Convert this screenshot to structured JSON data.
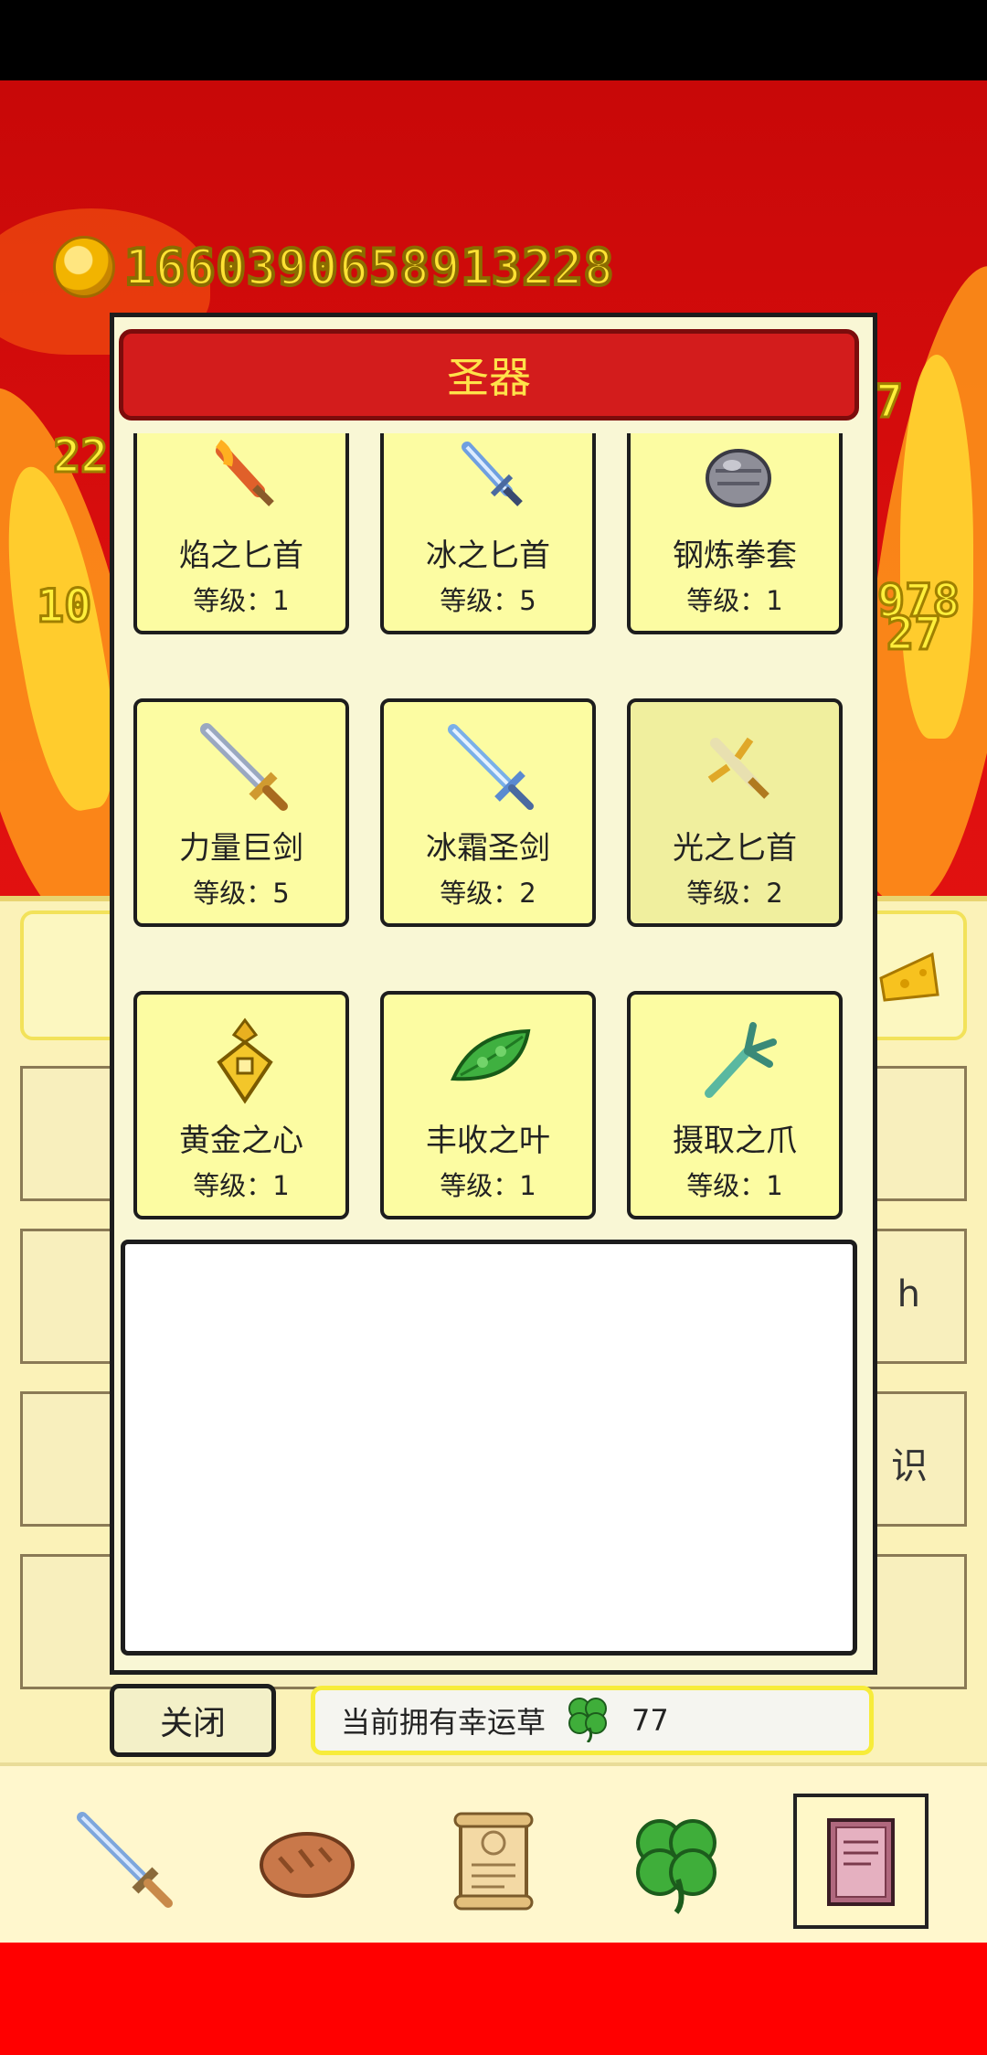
{
  "gold": {
    "amount": "1660390658913228"
  },
  "floating_numbers": [
    "22",
    "10",
    "978",
    "27",
    "7"
  ],
  "dialog": {
    "title": "圣器",
    "items": [
      {
        "name": "焰之匕首",
        "level": "等级：1",
        "icon": "flame-dagger-icon"
      },
      {
        "name": "冰之匕首",
        "level": "等级：5",
        "icon": "ice-dagger-icon"
      },
      {
        "name": "钢炼拳套",
        "level": "等级：1",
        "icon": "steel-gauntlet-icon"
      },
      {
        "name": "力量巨剑",
        "level": "等级：5",
        "icon": "power-greatsword-icon"
      },
      {
        "name": "冰霜圣剑",
        "level": "等级：2",
        "icon": "frost-holy-sword-icon"
      },
      {
        "name": "光之匕首",
        "level": "等级：2",
        "icon": "light-dagger-icon"
      },
      {
        "name": "黄金之心",
        "level": "等级：1",
        "icon": "golden-heart-icon"
      },
      {
        "name": "丰收之叶",
        "level": "等级：1",
        "icon": "harvest-leaf-icon"
      },
      {
        "name": "摄取之爪",
        "level": "等级：1",
        "icon": "grab-claw-icon"
      }
    ],
    "selected_index": 5,
    "close_label": "关闭",
    "clover_label": "当前拥有幸运草",
    "clover_count": "77"
  },
  "background_text": {
    "partial_1": "h",
    "partial_2": "识"
  },
  "tabs": [
    "sword-icon",
    "bread-icon",
    "scroll-icon",
    "clover-icon",
    "book-icon"
  ],
  "active_tab": 4,
  "colors": {
    "title_bg": "#d31c1c",
    "title_text": "#ffe24a",
    "card_bg": "#fcfca2",
    "gold_text": "#ffe233"
  }
}
